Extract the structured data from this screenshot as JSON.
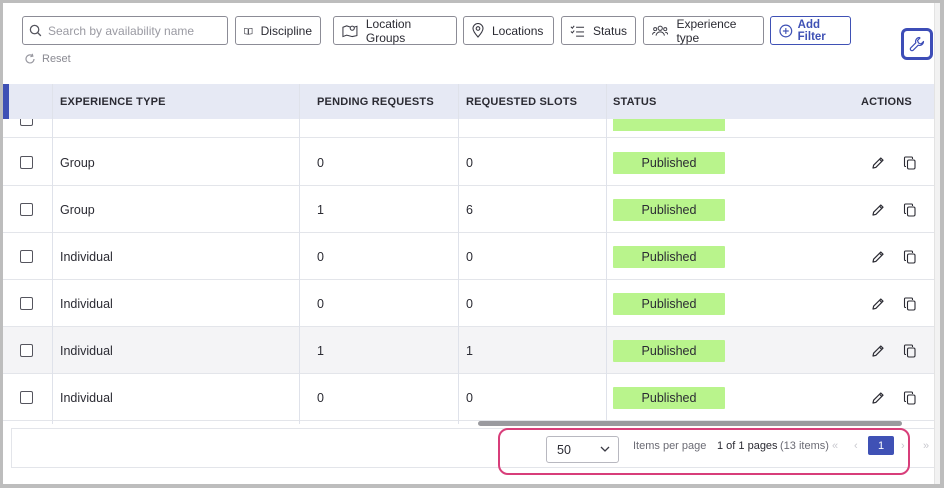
{
  "filters": {
    "search_placeholder": "Search by availability name",
    "discipline": "Discipline",
    "location_groups": "Location Groups",
    "locations": "Locations",
    "status": "Status",
    "experience_type": "Experience type",
    "add_filter": "Add Filter",
    "reset": "Reset"
  },
  "table": {
    "columns": [
      "EXPERIENCE TYPE",
      "PENDING REQUESTS",
      "REQUESTED SLOTS",
      "STATUS",
      "ACTIONS"
    ],
    "rows": [
      {
        "experience_type": "Group",
        "pending_requests": "0",
        "requested_slots": "0",
        "status": "Published"
      },
      {
        "experience_type": "Group",
        "pending_requests": "1",
        "requested_slots": "6",
        "status": "Published"
      },
      {
        "experience_type": "Individual",
        "pending_requests": "0",
        "requested_slots": "0",
        "status": "Published"
      },
      {
        "experience_type": "Individual",
        "pending_requests": "0",
        "requested_slots": "0",
        "status": "Published"
      },
      {
        "experience_type": "Individual",
        "pending_requests": "1",
        "requested_slots": "1",
        "status": "Published"
      },
      {
        "experience_type": "Individual",
        "pending_requests": "0",
        "requested_slots": "0",
        "status": "Published"
      }
    ],
    "status_color": "#b9f48c"
  },
  "pagination": {
    "per_page_value": "50",
    "per_page_label": "Items per page",
    "page_range": "1 of 1 pages",
    "item_count": "(13 items)",
    "current_page": "1"
  },
  "colors": {
    "accent": "#3f51b5",
    "highlight": "#d83e7a"
  }
}
